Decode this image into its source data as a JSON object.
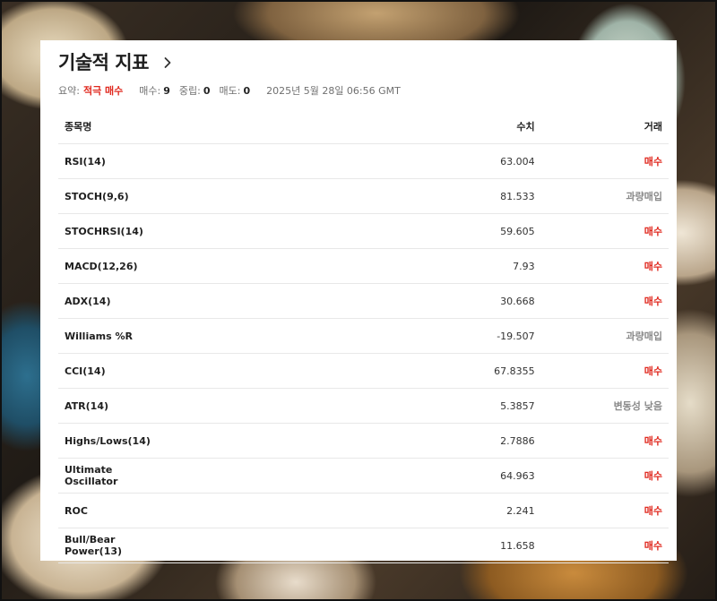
{
  "header": {
    "title": "기술적 지표"
  },
  "summary": {
    "label": "요약:",
    "verdict": "적극 매수",
    "buy_label": "매수:",
    "buy_count": "9",
    "neutral_label": "중립:",
    "neutral_count": "0",
    "sell_label": "매도:",
    "sell_count": "0",
    "timestamp": "2025년 5월 28일 06:56 GMT"
  },
  "table": {
    "columns": [
      "종목명",
      "수치",
      "거래"
    ],
    "rows": [
      {
        "name": "RSI(14)",
        "value": "63.004",
        "action": "매수",
        "type": "buy"
      },
      {
        "name": "STOCH(9,6)",
        "value": "81.533",
        "action": "과량매입",
        "type": "neutral"
      },
      {
        "name": "STOCHRSI(14)",
        "value": "59.605",
        "action": "매수",
        "type": "buy"
      },
      {
        "name": "MACD(12,26)",
        "value": "7.93",
        "action": "매수",
        "type": "buy"
      },
      {
        "name": "ADX(14)",
        "value": "30.668",
        "action": "매수",
        "type": "buy"
      },
      {
        "name": "Williams %R",
        "value": "-19.507",
        "action": "과량매입",
        "type": "neutral"
      },
      {
        "name": "CCI(14)",
        "value": "67.8355",
        "action": "매수",
        "type": "buy"
      },
      {
        "name": "ATR(14)",
        "value": "5.3857",
        "action": "변동성 낮음",
        "type": "neutral"
      },
      {
        "name": "Highs/Lows(14)",
        "value": "2.7886",
        "action": "매수",
        "type": "buy"
      },
      {
        "name": "Ultimate Oscillator",
        "value": "64.963",
        "action": "매수",
        "type": "buy"
      },
      {
        "name": "ROC",
        "value": "2.241",
        "action": "매수",
        "type": "buy"
      },
      {
        "name": "Bull/Bear Power(13)",
        "value": "11.658",
        "action": "매수",
        "type": "buy"
      }
    ]
  },
  "colors": {
    "buy": "#e0291f",
    "neutral": "#8a8a8a"
  },
  "icons": {
    "title_link": "chevron-right-icon"
  }
}
